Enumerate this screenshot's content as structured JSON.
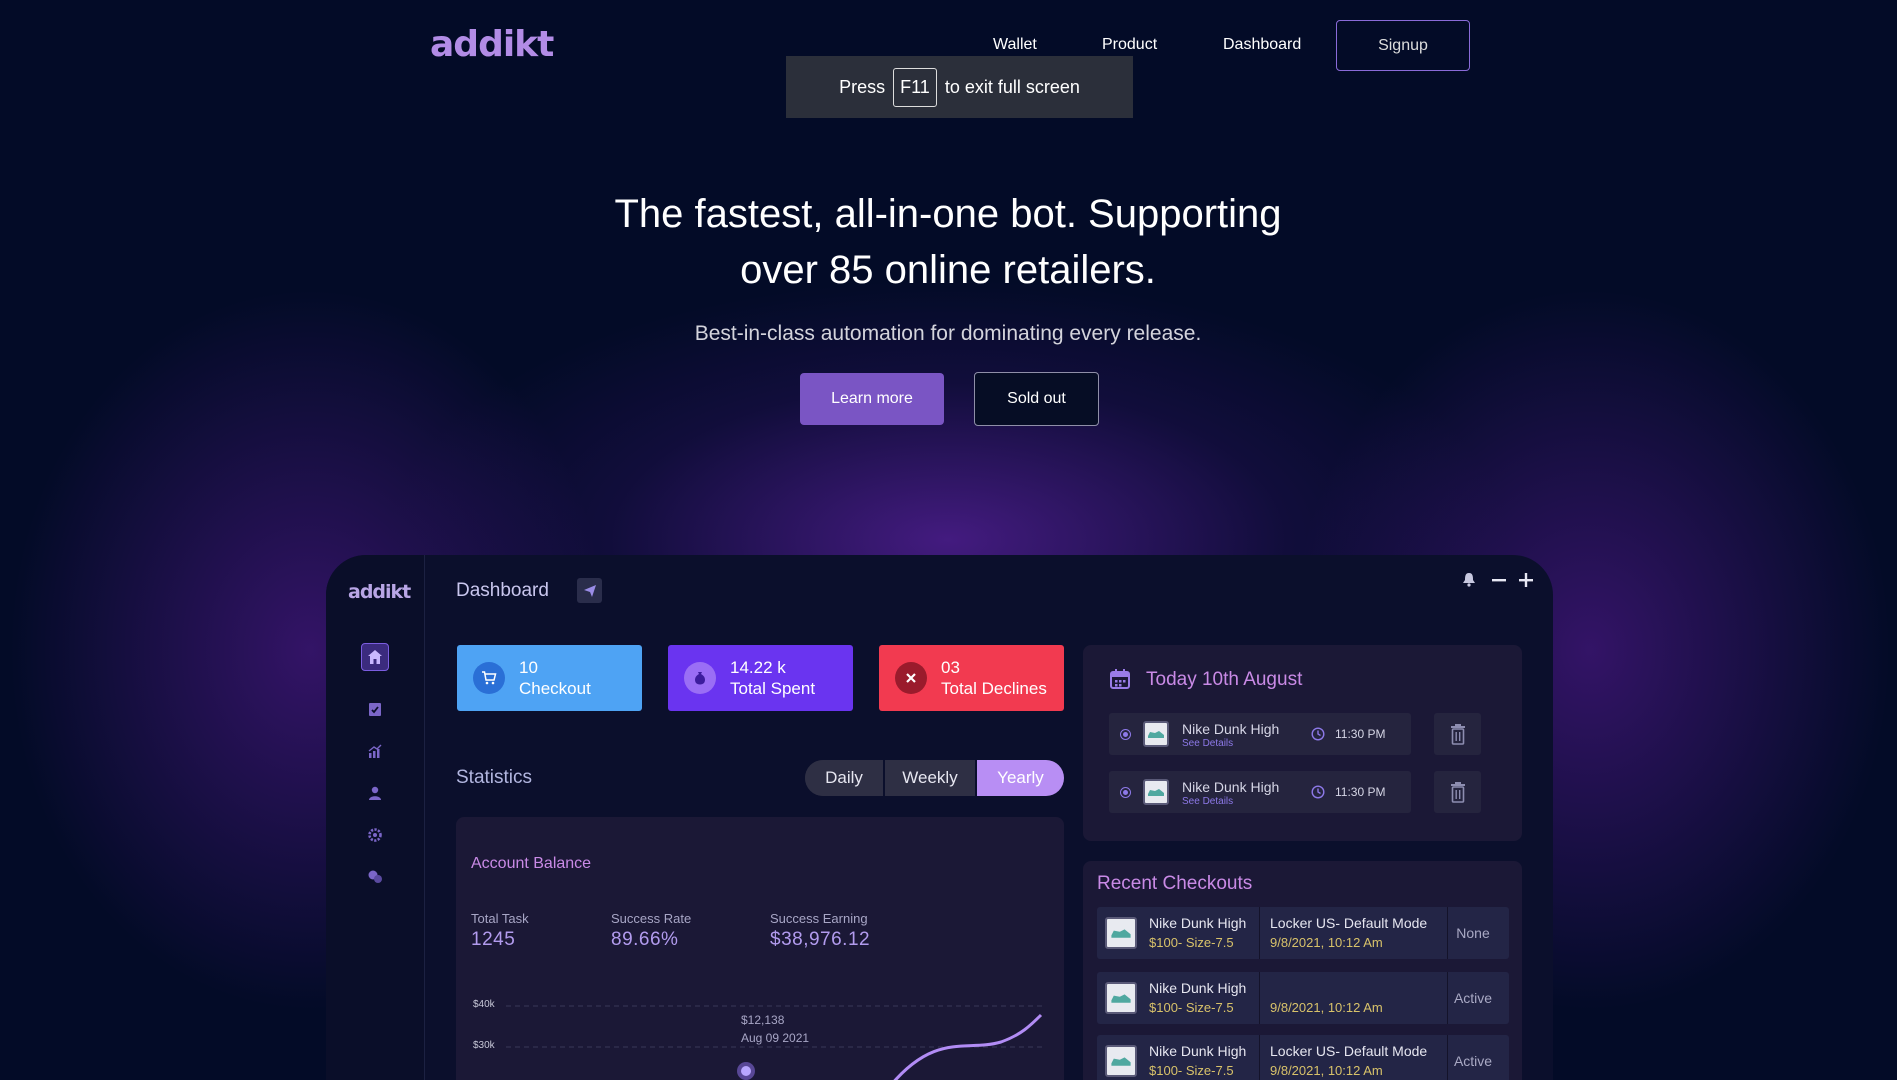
{
  "nav": {
    "logo": "addikt",
    "links": [
      "Wallet",
      "Product",
      "Dashboard"
    ],
    "signup": "Signup"
  },
  "fullscreen_notice": {
    "prefix": "Press",
    "key": "F11",
    "suffix": "to exit full screen"
  },
  "hero": {
    "title_line1": "The fastest, all-in-one bot. Supporting",
    "title_line2": "over 85 online retailers.",
    "subtitle": "Best-in-class automation for dominating every release.",
    "learn_more": "Learn more",
    "sold_out": "Sold out"
  },
  "dashboard": {
    "logo": "addikt",
    "title": "Dashboard",
    "sidebar_icons": [
      "home-icon",
      "checklist-icon",
      "analytics-icon",
      "user-icon",
      "settings-icon",
      "chat-icon"
    ],
    "cards": [
      {
        "value": "10",
        "label": "Checkout",
        "color": "#4ea3f4",
        "icon": "cart-icon"
      },
      {
        "value": "14.22 k",
        "label": "Total Spent",
        "color": "#6a34f0",
        "icon": "money-bag-icon"
      },
      {
        "value": "03",
        "label": "Total Declines",
        "color": "#f23a50",
        "icon": "close-icon"
      }
    ],
    "statistics": {
      "label": "Statistics",
      "periods": [
        "Daily",
        "Weekly",
        "Yearly"
      ],
      "selected": "Yearly"
    },
    "account_balance": {
      "title": "Account Balance",
      "metrics": [
        {
          "label": "Total Task",
          "value": "1245"
        },
        {
          "label": "Success Rate",
          "value": "89.66%"
        },
        {
          "label": "Success Earning",
          "value": "$38,976.12"
        }
      ],
      "y_ticks": [
        "$40k",
        "$30k"
      ],
      "tooltip_value": "$12,138",
      "tooltip_date": "Aug 09 2021"
    },
    "today": {
      "title": "Today 10th August",
      "items": [
        {
          "name": "Nike Dunk High",
          "link": "See Details",
          "time": "11:30 PM"
        },
        {
          "name": "Nike Dunk High",
          "link": "See Details",
          "time": "11:30 PM"
        }
      ]
    },
    "recent": {
      "title": "Recent Checkouts",
      "rows": [
        {
          "name": "Nike Dunk High",
          "price": "$100- Size-7.5",
          "mode": "Locker US- Default Mode",
          "date": "9/8/2021, 10:12 Am",
          "status": "None"
        },
        {
          "name": "Nike Dunk High",
          "price": "$100- Size-7.5",
          "mode": "",
          "date": "9/8/2021, 10:12 Am",
          "status": "Active"
        },
        {
          "name": "Nike Dunk High",
          "price": "$100- Size-7.5",
          "mode": "Locker US- Default Mode",
          "date": "9/8/2021, 10:12 Am",
          "status": "Active"
        }
      ]
    }
  }
}
